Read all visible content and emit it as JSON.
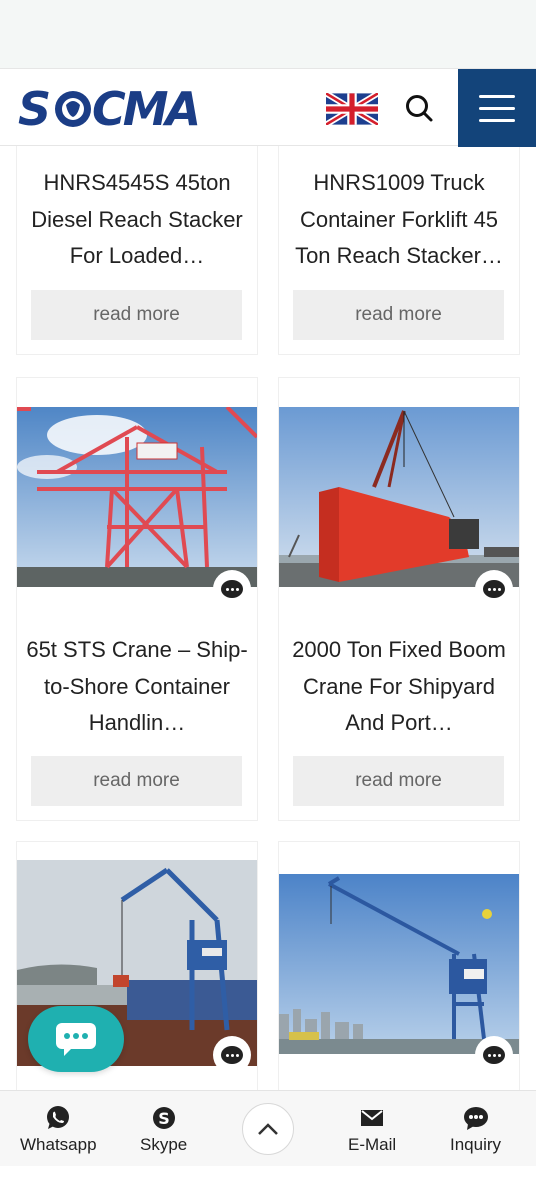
{
  "brand": {
    "logo_text": "SOCMA"
  },
  "header": {
    "language": "English"
  },
  "products": [
    {
      "title": "HNRS4545S 45ton Diesel Reach Stacker For Loaded…",
      "button": "read more"
    },
    {
      "title": "HNRS1009 Truck Container Forklift 45 Ton Reach Stacker…",
      "button": "read more"
    },
    {
      "title": "65t STS Crane – Ship-to-Shore Container Handlin…",
      "button": "read more"
    },
    {
      "title": "2000 Ton Fixed Boom Crane For Shipyard And Port…",
      "button": "read more"
    }
  ],
  "bottom_nav": {
    "whatsapp": "Whatsapp",
    "skype": "Skype",
    "email": "E-Mail",
    "inquiry": "Inquiry"
  },
  "colors": {
    "brand_blue": "#1b3d86",
    "menu_bg": "#13447a",
    "chat_teal": "#1fb0b0"
  }
}
